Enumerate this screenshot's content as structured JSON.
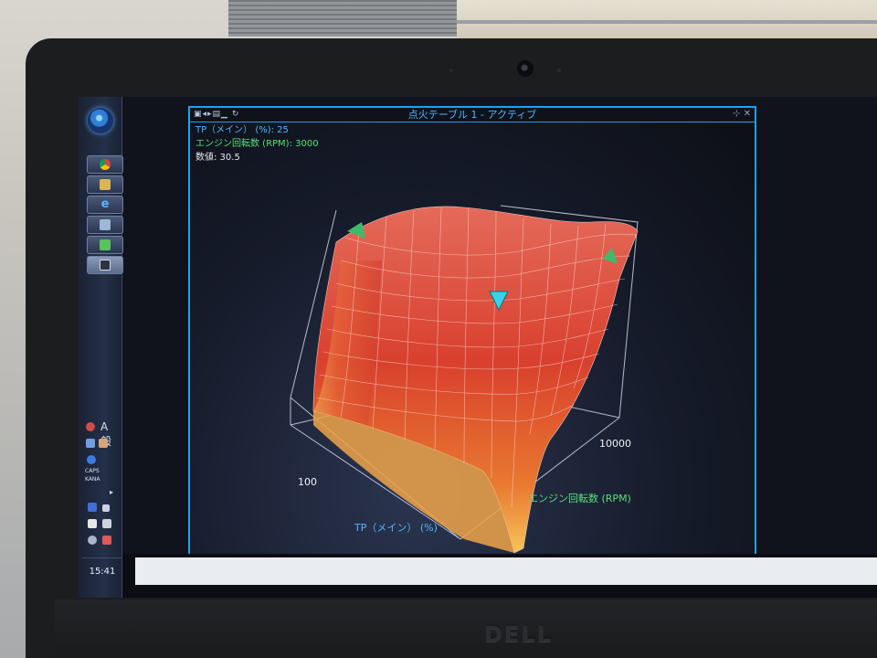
{
  "window": {
    "title": "点火テーブル 1 - アクティブ",
    "controls_left": "▣◂▸▤▁ ↻",
    "controls_right": "⊹ ✕"
  },
  "readout": {
    "tp_label": "TP（メイン） (%): 25",
    "rpm_label": "エンジン回転数 (RPM): 3000",
    "value_label": "数値: 30.5"
  },
  "axes": {
    "tp_axis_label": "TP（メイン） (%)",
    "rpm_axis_label": "エンジン回転数 (RPM)",
    "tp_tick": "100",
    "rpm_tick": "10000"
  },
  "taskbar": {
    "clock": "15:41",
    "ime_label": "A 般",
    "caps_label": "CAPS",
    "kana_label": "KANA"
  },
  "brand": "DELL",
  "colors": {
    "window_border": "#1aa3f0",
    "tp_text": "#4fb7ff",
    "rpm_text": "#57e07a",
    "value_text": "#e6e9ef",
    "surface_high": "#d9402e",
    "surface_low": "#f1b04a",
    "cursor": "#39d2e6"
  }
}
